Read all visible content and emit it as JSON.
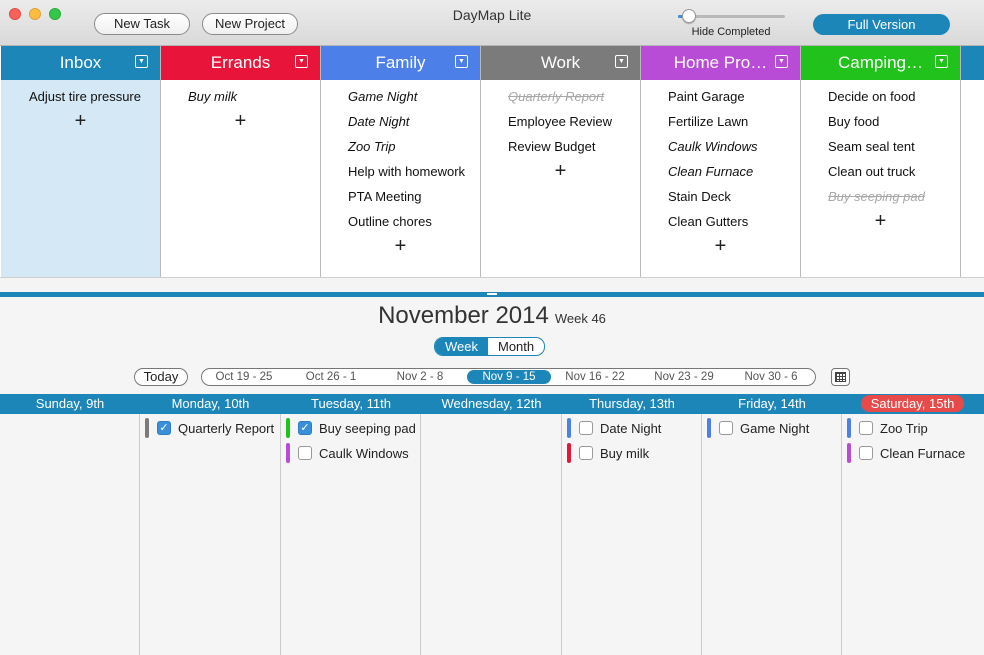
{
  "app": {
    "title": "DayMap Lite",
    "new_task_label": "New Task",
    "new_project_label": "New Project",
    "hide_completed_label": "Hide Completed",
    "hide_completed_level": 0.1,
    "full_version_label": "Full Version"
  },
  "projects": [
    {
      "name": "Inbox",
      "color": "#1d86b8",
      "highlight": true,
      "tasks": [
        {
          "text": "Adjust tire pressure",
          "style": "normal"
        }
      ]
    },
    {
      "name": "Errands",
      "color": "#e8143a",
      "tasks": [
        {
          "text": "Buy milk",
          "style": "italic"
        }
      ]
    },
    {
      "name": "Family",
      "color": "#4c7fe8",
      "tasks": [
        {
          "text": "Game Night",
          "style": "italic"
        },
        {
          "text": "Date Night",
          "style": "italic"
        },
        {
          "text": "Zoo Trip",
          "style": "italic"
        },
        {
          "text": "Help with homework",
          "style": "normal"
        },
        {
          "text": "PTA Meeting",
          "style": "normal"
        },
        {
          "text": "Outline chores",
          "style": "normal"
        }
      ]
    },
    {
      "name": "Work",
      "color": "#7b7b7b",
      "tasks": [
        {
          "text": "Quarterly Report",
          "style": "done"
        },
        {
          "text": "Employee Review",
          "style": "normal"
        },
        {
          "text": "Review Budget",
          "style": "normal"
        }
      ]
    },
    {
      "name": "Home Pro…",
      "color": "#b94cd6",
      "tasks": [
        {
          "text": "Paint Garage",
          "style": "normal"
        },
        {
          "text": "Fertilize Lawn",
          "style": "normal"
        },
        {
          "text": "Caulk Windows",
          "style": "italic"
        },
        {
          "text": "Clean Furnace",
          "style": "italic"
        },
        {
          "text": "Stain Deck",
          "style": "normal"
        },
        {
          "text": "Clean Gutters",
          "style": "normal"
        }
      ]
    },
    {
      "name": "Camping…",
      "color": "#22c21c",
      "tasks": [
        {
          "text": "Decide on food",
          "style": "normal"
        },
        {
          "text": "Buy food",
          "style": "normal"
        },
        {
          "text": "Seam seal tent",
          "style": "normal"
        },
        {
          "text": "Clean out truck",
          "style": "normal"
        },
        {
          "text": "Buy seeping pad",
          "style": "done"
        }
      ]
    }
  ],
  "add_glyph": "+",
  "dropdown_glyph": "▼",
  "calendar": {
    "month": "November 2014",
    "week": "Week 46",
    "view_week": "Week",
    "view_month": "Month",
    "active_view": "Week",
    "today_label": "Today",
    "ranges": [
      "Oct 19 - 25",
      "Oct 26 - 1",
      "Nov 2 - 8",
      "Nov 9 - 15",
      "Nov 16 - 22",
      "Nov 23 - 29",
      "Nov 30 - 6"
    ],
    "active_range": 3,
    "days": [
      {
        "label": "Sunday, 9th",
        "events": []
      },
      {
        "label": "Monday, 10th",
        "events": [
          {
            "text": "Quarterly Report",
            "checked": true,
            "color": "#7b7b7b"
          }
        ]
      },
      {
        "label": "Tuesday, 11th",
        "events": [
          {
            "text": "Buy seeping pad",
            "checked": true,
            "color": "#22c21c"
          },
          {
            "text": "Caulk Windows",
            "checked": false,
            "color": "#b94cd6"
          }
        ]
      },
      {
        "label": "Wednesday, 12th",
        "events": []
      },
      {
        "label": "Thursday, 13th",
        "events": [
          {
            "text": "Date Night",
            "checked": false,
            "color": "#4c7fe8"
          },
          {
            "text": "Buy milk",
            "checked": false,
            "color": "#e8143a"
          }
        ]
      },
      {
        "label": "Friday, 14th",
        "events": [
          {
            "text": "Game Night",
            "checked": false,
            "color": "#4c7fe8"
          }
        ]
      },
      {
        "label": "Saturday, 15th",
        "today": true,
        "events": [
          {
            "text": "Zoo Trip",
            "checked": false,
            "color": "#4c7fe8"
          },
          {
            "text": "Clean Furnace",
            "checked": false,
            "color": "#b94cd6"
          }
        ]
      }
    ]
  }
}
